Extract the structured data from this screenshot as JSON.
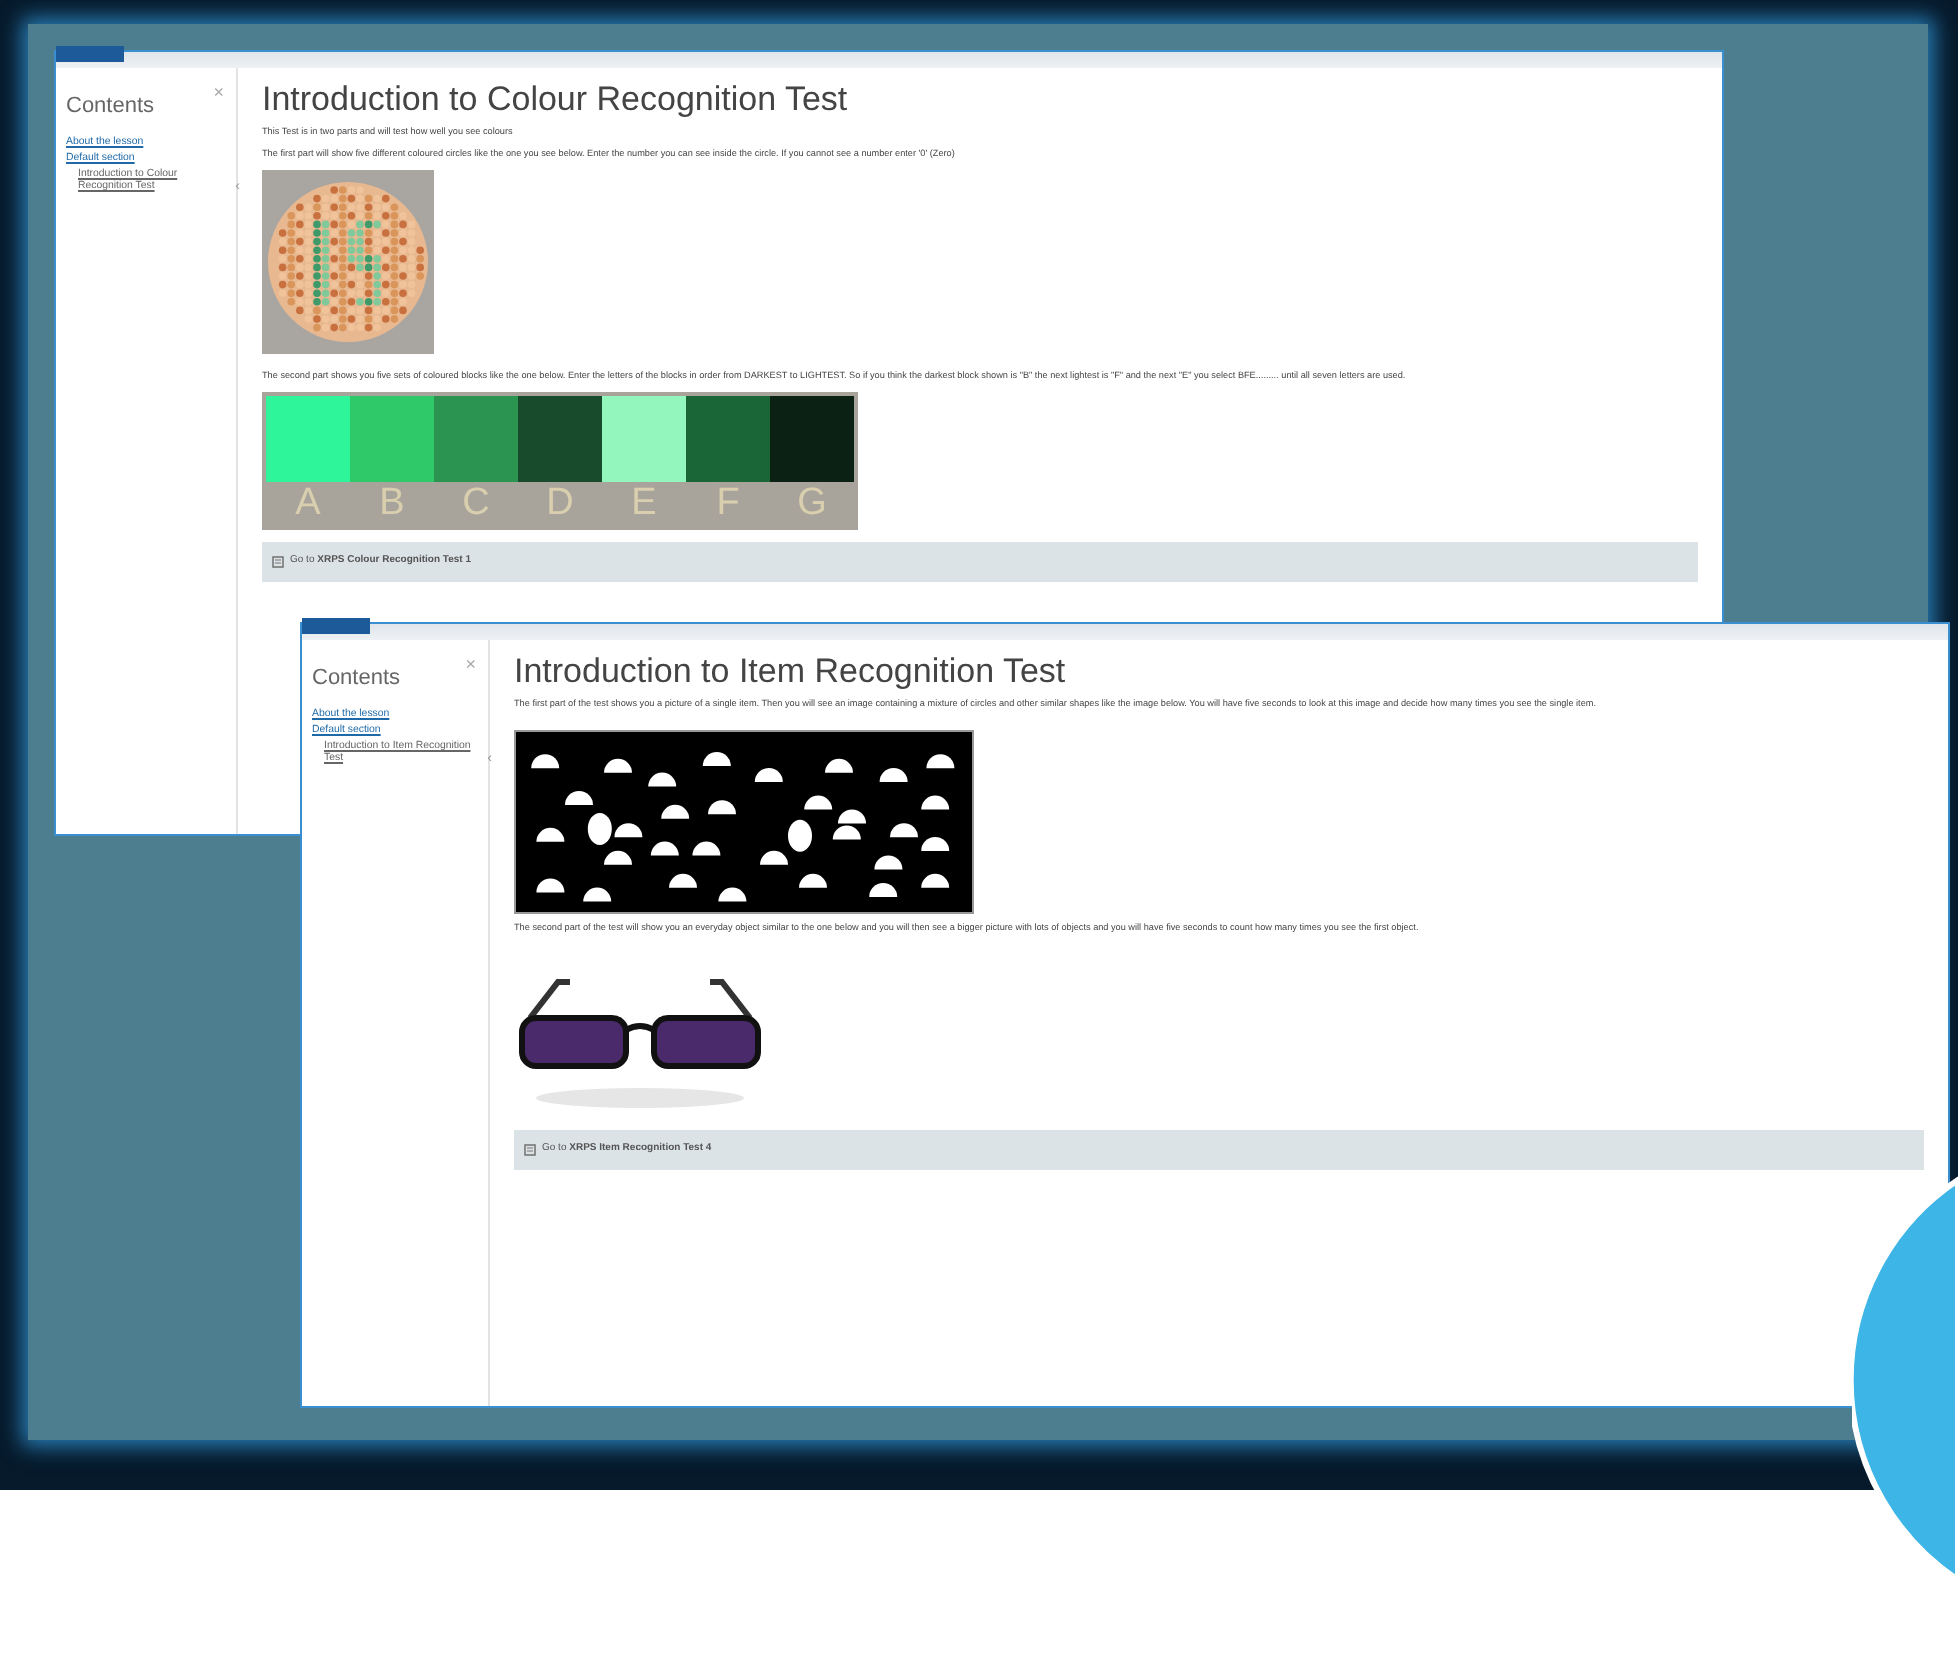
{
  "windows": [
    {
      "kind": "colour",
      "sidebar": {
        "title": "Contents",
        "close": "×",
        "collapse": "‹",
        "items": [
          {
            "label": "About the lesson"
          },
          {
            "label": "Default section",
            "children": [
              {
                "label": "Introduction to Colour Recognition Test"
              }
            ]
          }
        ]
      },
      "title": "Introduction to Colour Recognition Test",
      "paragraphs": [
        "This Test is in two parts and will test how well you see colours",
        "The first part will show five different coloured circles like the one you see below. Enter the number you can see inside the circle. If you cannot see a number enter '0' (Zero)"
      ],
      "second_paragraph": "The second part shows you five sets of coloured blocks like the one below. Enter the letters of the blocks in order from DARKEST to LIGHTEST.  So if you think the darkest block shown is \"B\" the next lightest is \"F\" and the next \"E\" you select BFE......... until all seven letters are used.",
      "blocks": [
        {
          "letter": "A",
          "color": "#2ef59a"
        },
        {
          "letter": "B",
          "color": "#30c96a"
        },
        {
          "letter": "C",
          "color": "#2a9450"
        },
        {
          "letter": "D",
          "color": "#184a2c"
        },
        {
          "letter": "E",
          "color": "#93f7bd"
        },
        {
          "letter": "F",
          "color": "#1a6636"
        },
        {
          "letter": "G",
          "color": "#0a2113"
        }
      ],
      "link": "Go to **XRPS Colour Recognition Test 1**"
    },
    {
      "kind": "item",
      "sidebar": {
        "title": "Contents",
        "close": "×",
        "collapse": "‹",
        "items": [
          {
            "label": "About the lesson"
          },
          {
            "label": "Default section",
            "children": [
              {
                "label": "Introduction to Item Recognition Test"
              }
            ]
          }
        ]
      },
      "title": "Introduction to Item Recognition Test",
      "paragraphs": [
        "The first part of the test shows you a picture of a single item. Then you will see an image containing a mixture of circles and other similar shapes like the image below. You will have five seconds to look at this image and decide how many times you see the single item."
      ],
      "second_paragraph": "The second part of the test will show you an everyday object similar to the one below and you will then see a bigger picture with lots of objects and you will have five seconds to count how many times you see the first object.",
      "link": "Go to **XRPS Item Recognition Test 4**"
    }
  ]
}
